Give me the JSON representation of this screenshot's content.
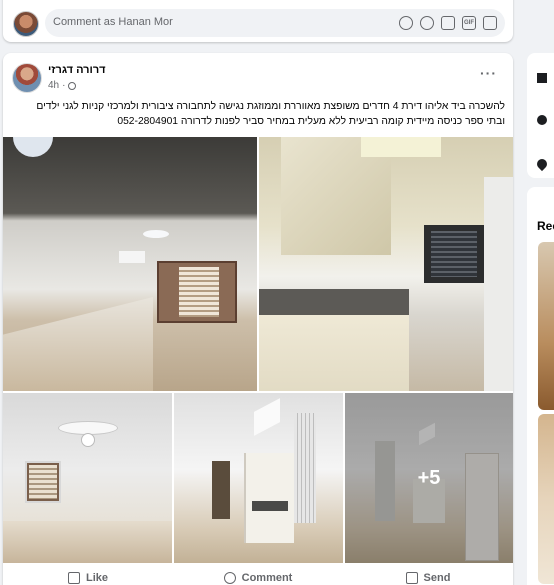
{
  "comment": {
    "placeholder": "Comment as Hanan Mor",
    "tools": [
      "sticker-icon",
      "emoji-icon",
      "camera-icon",
      "gif-icon",
      "avatar-sticker-icon"
    ],
    "tool_labels": {
      "gif": "GIF"
    }
  },
  "post": {
    "author": "דרורה דגרזי",
    "time": "4h",
    "text_line1": "להשכרה ביד אליהו דירת 4 חדרים משופצת מאווררת וממוזגת נגישה לתחבורה ציבורית ולמרכזי קניות לגני ילדים",
    "text_line2": "ובתי ספר כניסה מיידית קומה רביעית ללא מעלית במחיר סביר לפנות לדרורה 052-2804901",
    "more_photos": "+5",
    "actions": {
      "like": "Like",
      "comment": "Comment",
      "send": "Send"
    }
  },
  "sidebar": {
    "section_title": "Rec"
  }
}
